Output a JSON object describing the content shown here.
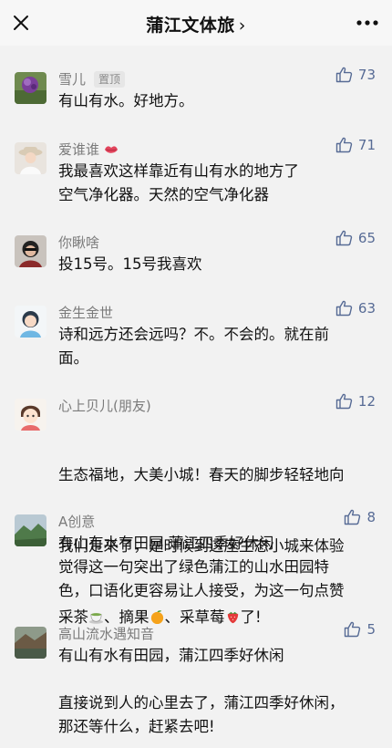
{
  "header": {
    "title": "蒲江文体旅",
    "chevron": "›",
    "close_icon": "close-icon",
    "more_icon": "more-dots-icon"
  },
  "colors": {
    "link_blue": "#576b95",
    "name_gray": "#7b7b7b",
    "background": "#f2f2f2"
  },
  "comments": [
    {
      "name": "雪儿",
      "badge": "置顶",
      "likes": "73",
      "text": "有山有水。好地方。"
    },
    {
      "name": "爱谁谁",
      "name_icon": "red-lips-icon",
      "likes": "71",
      "text": "我最喜欢这样靠近有山有水的地方了\n空气净化器。天然的空气净化器"
    },
    {
      "name": "你瞅啥",
      "likes": "65",
      "text": "投15号。15号我喜欢"
    },
    {
      "name": "金生金世",
      "likes": "63",
      "text": "诗和远方还会远吗？不。不会的。就在前\n面。"
    },
    {
      "name": "心上贝儿(朋友)",
      "likes": "12",
      "text_lines": [
        "生态福地，大美小城！春天的脚步轻轻地向",
        "我们走来了，是时候到这座生态小城来体验"
      ],
      "text_parts": [
        "采茶",
        "、摘果",
        "、采草莓",
        "了!"
      ],
      "emojis": [
        "tea-cup-icon",
        "tangerine-icon",
        "strawberry-icon"
      ]
    },
    {
      "name": "A创意",
      "likes": "8",
      "text": "有山有水有田园 蒲江四季好休闲\n觉得这一句突出了绿色蒲江的山水田园特\n色，口语化更容易让人接受，为这一句点赞"
    },
    {
      "name": "高山流水遇知音",
      "likes": "5",
      "text": "有山有水有田园，蒲江四季好休闲\n\n直接说到人的心里去了，蒲江四季好休闲，\n那还等什么，赶紧去吧!"
    }
  ]
}
